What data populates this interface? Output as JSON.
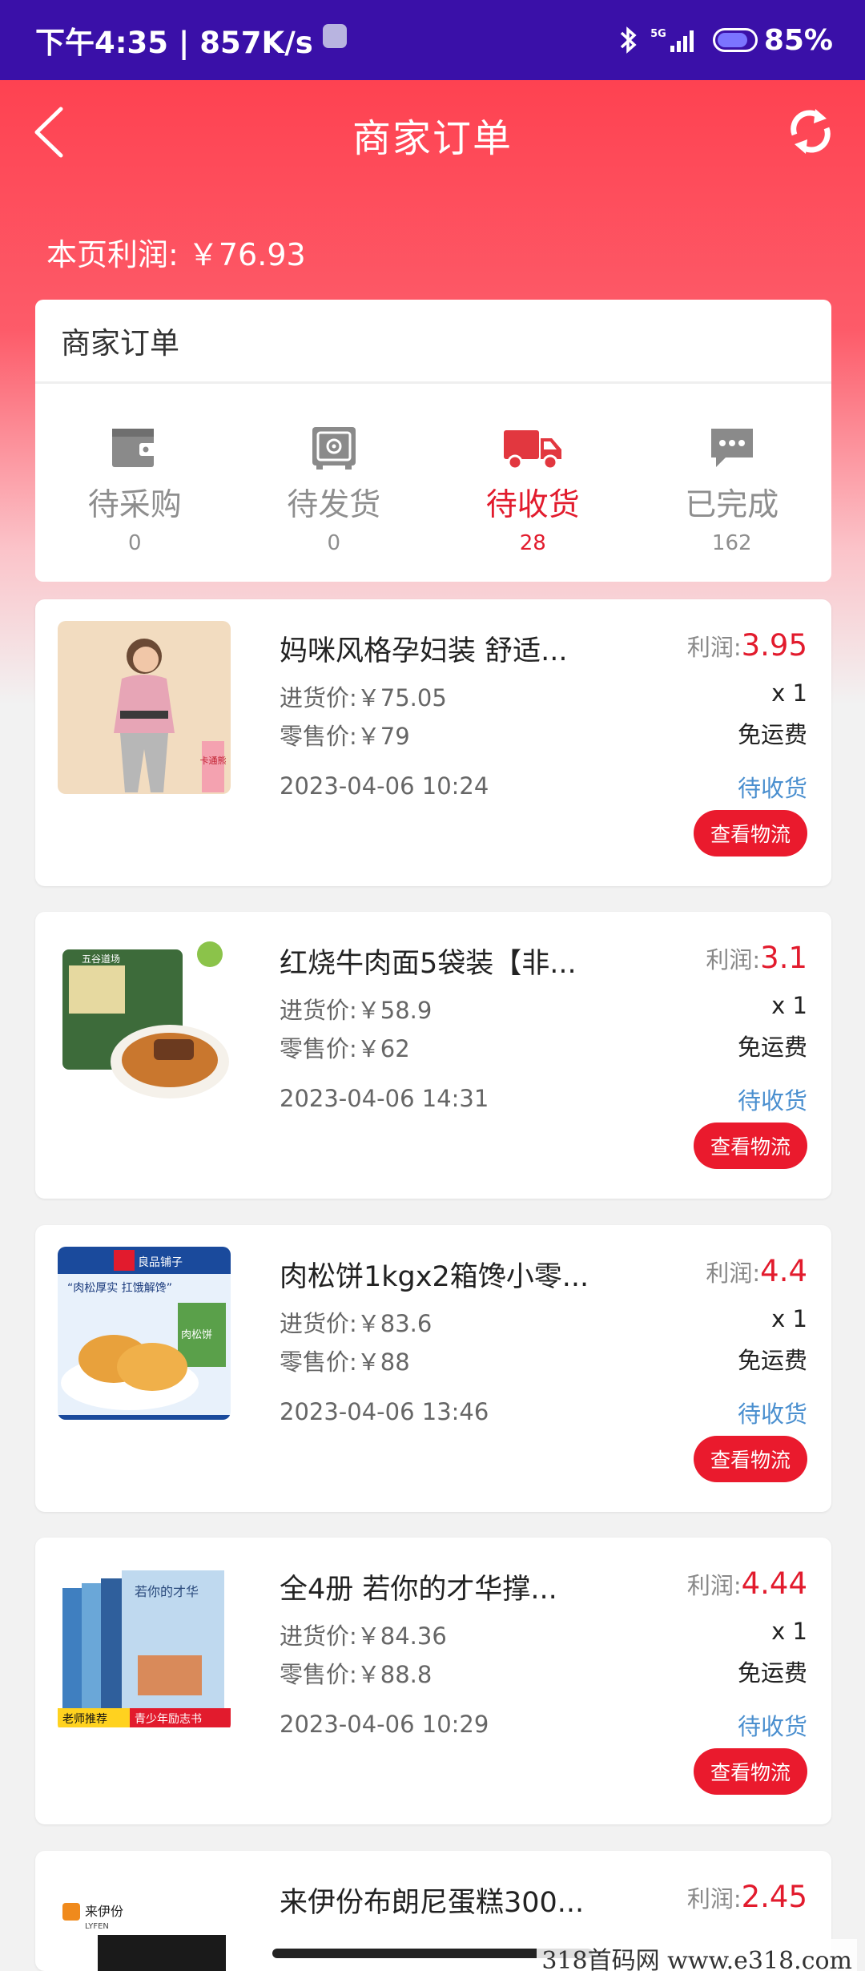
{
  "status_bar": {
    "time_speed": "下午4:35 | 857K/s",
    "network": "5G",
    "battery": "85%"
  },
  "nav": {
    "title": "商家订单"
  },
  "page_profit": "本页利润: ￥76.93",
  "summary": {
    "title": "商家订单",
    "tabs": [
      {
        "label": "待采购",
        "count": "0",
        "icon": "wallet-icon",
        "active": false
      },
      {
        "label": "待发货",
        "count": "0",
        "icon": "safe-icon",
        "active": false
      },
      {
        "label": "待收货",
        "count": "28",
        "icon": "truck-icon",
        "active": true
      },
      {
        "label": "已完成",
        "count": "162",
        "icon": "chat-bubble-icon",
        "active": false
      }
    ]
  },
  "orders": [
    {
      "title": "妈咪风格孕妇装 舒适...",
      "cost": "进货价:￥75.05",
      "retail": "零售价:￥79",
      "date": "2023-04-06 10:24",
      "profit_label": "利润:",
      "profit": "3.95",
      "qty": "x 1",
      "shipping": "免运费",
      "status": "待收货",
      "button": "查看物流"
    },
    {
      "title": "红烧牛肉面5袋装【非...",
      "cost": "进货价:￥58.9",
      "retail": "零售价:￥62",
      "date": "2023-04-06 14:31",
      "profit_label": "利润:",
      "profit": "3.1",
      "qty": "x 1",
      "shipping": "免运费",
      "status": "待收货",
      "button": "查看物流"
    },
    {
      "title": "肉松饼1kgx2箱馋小零...",
      "cost": "进货价:￥83.6",
      "retail": "零售价:￥88",
      "date": "2023-04-06 13:46",
      "profit_label": "利润:",
      "profit": "4.4",
      "qty": "x 1",
      "shipping": "免运费",
      "status": "待收货",
      "button": "查看物流"
    },
    {
      "title": "全4册 若你的才华撑...",
      "cost": "进货价:￥84.36",
      "retail": "零售价:￥88.8",
      "date": "2023-04-06 10:29",
      "profit_label": "利润:",
      "profit": "4.44",
      "qty": "x 1",
      "shipping": "免运费",
      "status": "待收货",
      "button": "查看物流"
    },
    {
      "title": "来伊份布朗尼蛋糕300...",
      "profit_label": "利润:",
      "profit": "2.45"
    }
  ],
  "thumb_text": {
    "t1_tag": "卡通熊",
    "t2_brand": "五谷道场",
    "t3_brand": "良品铺子",
    "t3_slogan": "“肉松厚实 扛饿解馋”",
    "t3_product": "肉松饼",
    "t4_book": "若你的才华",
    "t4_banner_a": "老师推荐",
    "t4_banner_b": "青少年励志书",
    "t5_brand": "来伊份",
    "t5_brand_en": "LYFEN"
  },
  "watermark": "318首码网 www.e318.com"
}
